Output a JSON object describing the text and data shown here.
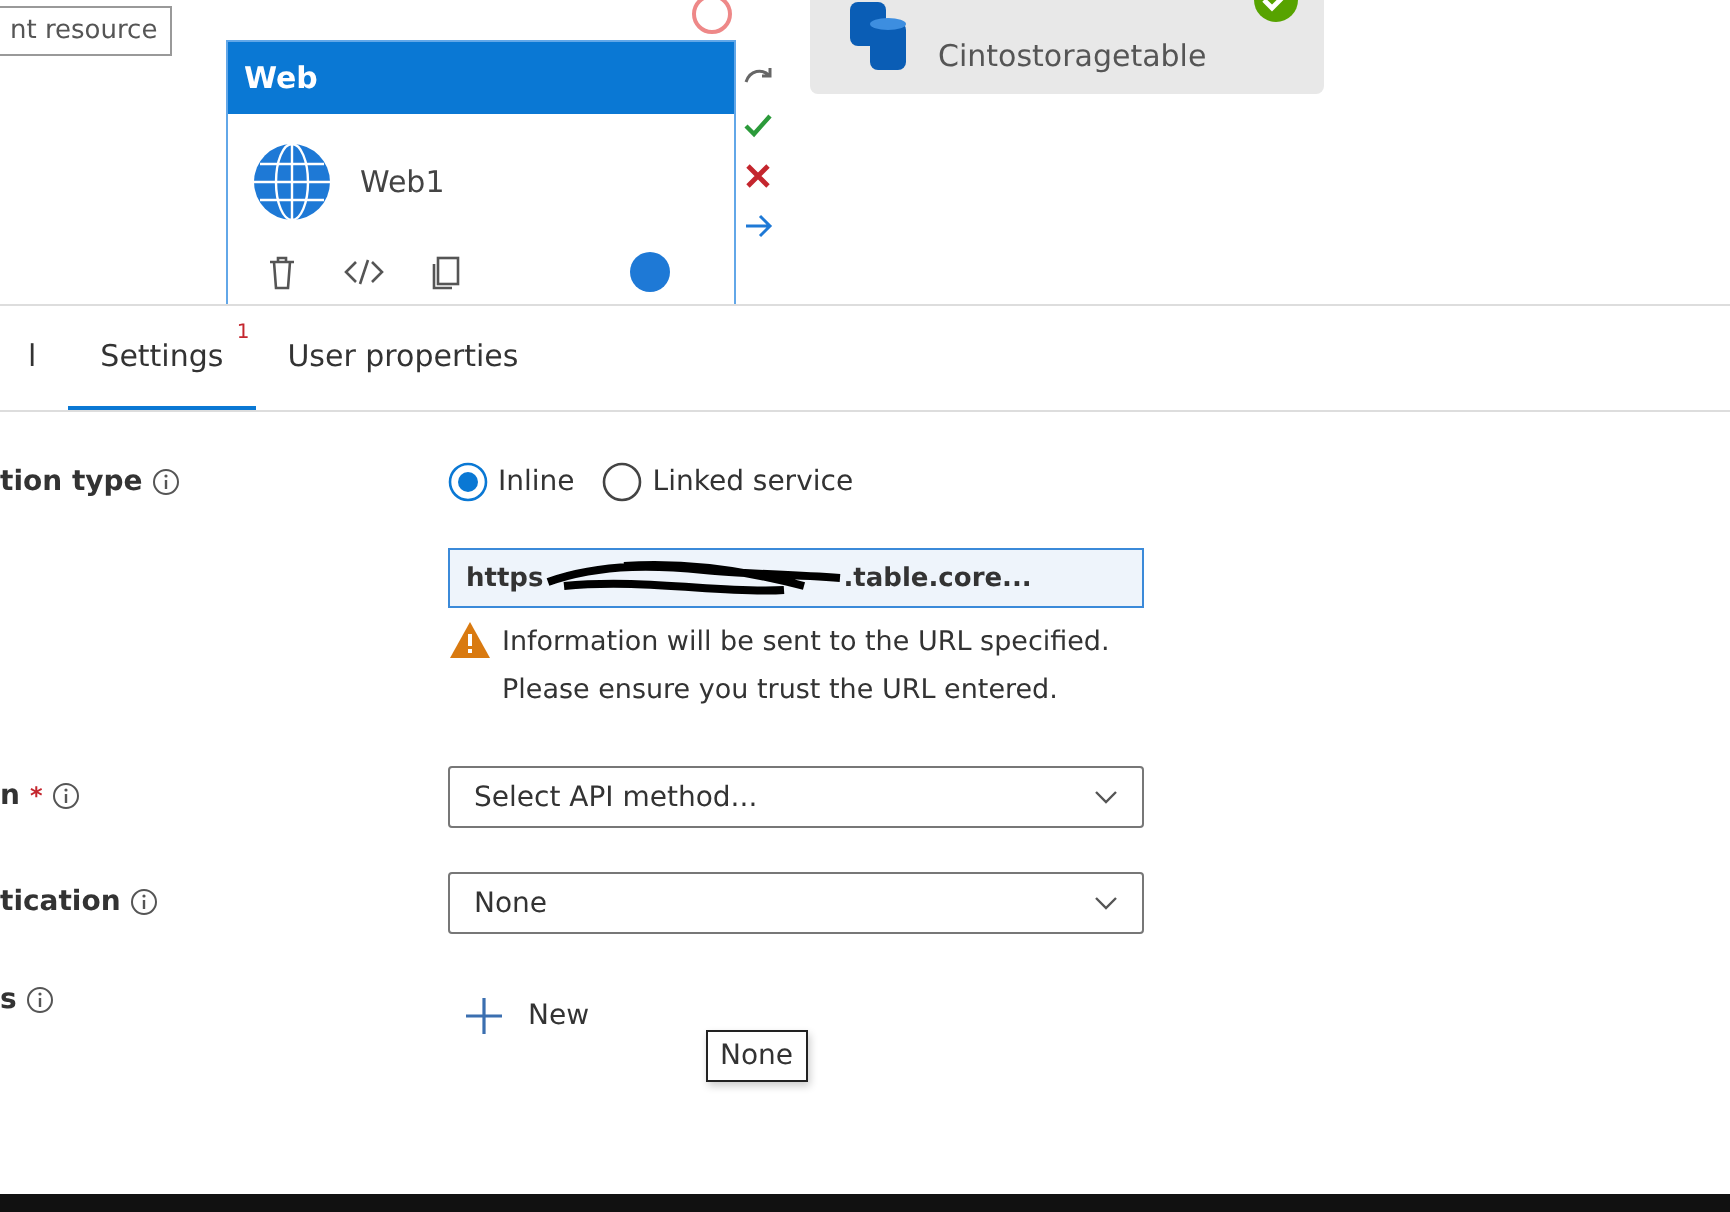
{
  "canvas": {
    "resource_box": {
      "text": "nt resource"
    },
    "web_activity": {
      "header": "Web",
      "name": "Web1"
    },
    "storage_activity": {
      "name": "Cintostoragetable",
      "succeeded": true
    }
  },
  "tabs": [
    {
      "label": "l",
      "selected": false
    },
    {
      "label": "Settings",
      "selected": true,
      "badge": "1"
    },
    {
      "label": "User properties",
      "selected": false
    }
  ],
  "form": {
    "rows": [
      {
        "kind": "radio",
        "label": "tion type",
        "options": [
          {
            "label": "Inline",
            "selected": true
          },
          {
            "label": "Linked service",
            "selected": false
          }
        ]
      },
      {
        "kind": "url",
        "value_start": "https",
        "value_end": ".table.core...",
        "warning": "Information will be sent to the URL specified. Please ensure you trust the URL entered."
      },
      {
        "kind": "select",
        "label": "n",
        "required_mark": "*",
        "value": "Select API method..."
      },
      {
        "kind": "select",
        "label": "tication",
        "value": "None"
      },
      {
        "kind": "add",
        "label": "s",
        "value": "New"
      }
    ]
  },
  "tooltip": {
    "text": "None"
  }
}
